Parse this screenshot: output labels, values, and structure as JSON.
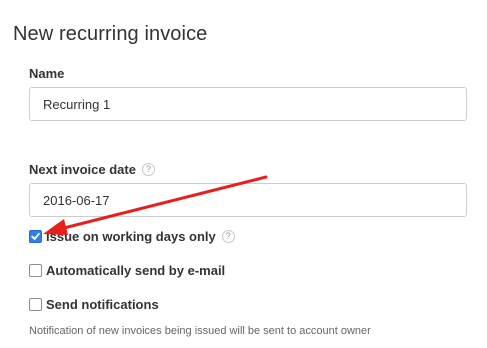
{
  "page": {
    "title": "New recurring invoice"
  },
  "form": {
    "name_label": "Name",
    "name_value": "Recurring 1",
    "next_date_label": "Next invoice date",
    "next_date_help": "?",
    "next_date_value": "2016-06-17",
    "working_days_label": "Issue on working days only",
    "working_days_help": "?",
    "working_days_checked": true,
    "auto_email_label": "Automatically send by e-mail",
    "auto_email_checked": false,
    "notifications_label": "Send notifications",
    "notifications_checked": false,
    "notifications_note": "Notification of new invoices being issued will be sent to account owner"
  },
  "colors": {
    "checkbox_checked": "#2f7fe8",
    "annotation_arrow": "#e8201c"
  },
  "icons": {
    "help": "question-mark-circle-icon",
    "checkmark": "checkmark-icon",
    "arrow": "red-annotation-arrow-icon"
  }
}
